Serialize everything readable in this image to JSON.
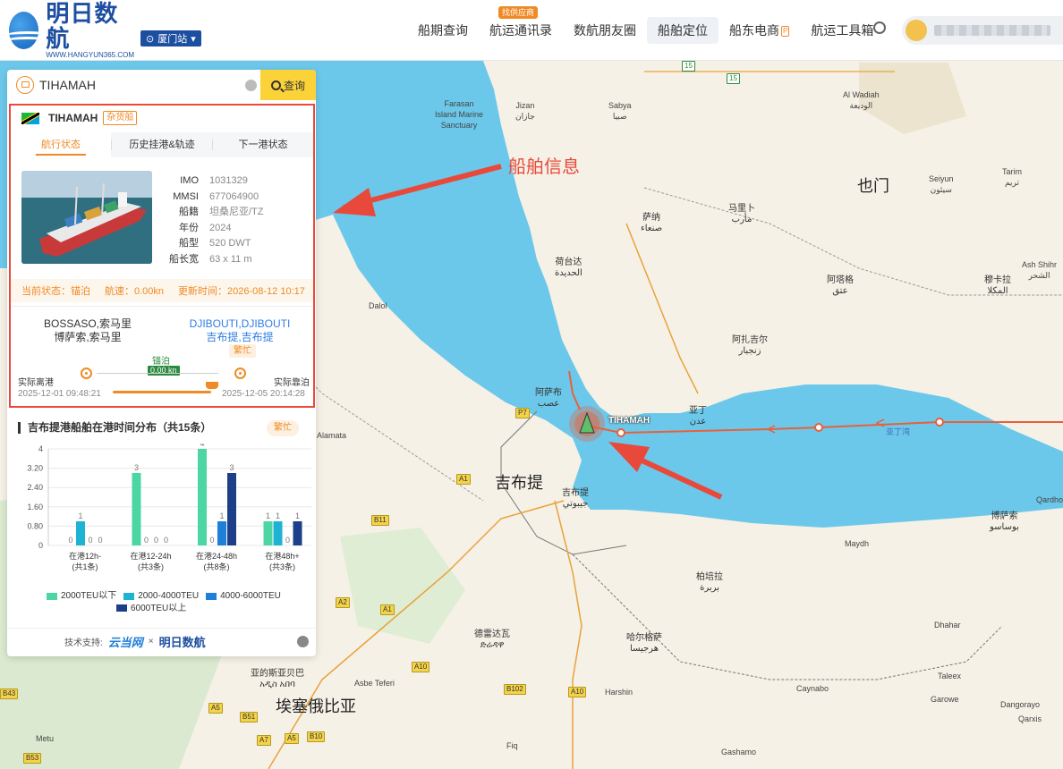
{
  "header": {
    "brand": "明日数航",
    "url": "WWW.HANGYUN365.COM",
    "station": "厦门站",
    "nav": [
      {
        "label": "船期查询",
        "badge": ""
      },
      {
        "label": "航运通讯录",
        "badge": "找供应商"
      },
      {
        "label": "数航朋友圈",
        "badge": ""
      },
      {
        "label": "船舶定位",
        "badge": ""
      },
      {
        "label": "船东电商",
        "badge": "P"
      },
      {
        "label": "航运工具箱",
        "badge": ""
      }
    ]
  },
  "search": {
    "value": "TIHAMAH",
    "button": "查询"
  },
  "vessel": {
    "name": "TIHAMAH",
    "type": "杂货船",
    "tabs": [
      "航行状态",
      "历史挂港&轨迹",
      "下一港状态"
    ],
    "props": [
      {
        "key": "IMO",
        "value": "1031329"
      },
      {
        "key": "MMSI",
        "value": "677064900"
      },
      {
        "key": "船籍",
        "value": "坦桑尼亚/TZ"
      },
      {
        "key": "年份",
        "value": "2024"
      },
      {
        "key": "船型",
        "value": "520 DWT"
      },
      {
        "key": "船长宽",
        "value": "63 x 11 m"
      }
    ],
    "status": {
      "state": "当前状态：锚泊",
      "speed": "航速：0.00kn",
      "updated": "更新时间：2026-08-12 10:17"
    },
    "voyage": {
      "from_en": "BOSSASO,索马里",
      "from_cn": "博萨索,索马里",
      "to_en": "DJIBOUTI,DJIBOUTI",
      "to_cn": "吉布提,吉布提",
      "busy": "繁忙",
      "anchor": "锚泊",
      "speed": "0.00 kn",
      "dep_label": "实际离港",
      "dep_time": "2025-12-01 09:48:21",
      "arr_label": "实际靠泊",
      "arr_time": "2025-12-05 20:14:28"
    }
  },
  "chart_data": {
    "type": "bar",
    "title": "吉布提港船舶在港时间分布（共15条）",
    "badge": "繁忙",
    "categories": [
      "在港12h-",
      "在港12-24h",
      "在港24-48h",
      "在港48h+"
    ],
    "category_sub": [
      "(共1条)",
      "(共3条)",
      "(共8条)",
      "(共3条)"
    ],
    "yticks": [
      "4",
      "3.20",
      "2.40",
      "1.60",
      "0.80",
      "0"
    ],
    "ylim": [
      0,
      4
    ],
    "series": [
      {
        "name": "2000TEU以下",
        "color": "#4cd6a3",
        "values": [
          0,
          3,
          4,
          1
        ]
      },
      {
        "name": "2000-4000TEU",
        "color": "#1fb3d3",
        "values": [
          1,
          0,
          0,
          1
        ]
      },
      {
        "name": "4000-6000TEU",
        "color": "#1e7ed8",
        "values": [
          0,
          0,
          1,
          0
        ]
      },
      {
        "name": "6000TEU以上",
        "color": "#1d3f8a",
        "values": [
          0,
          0,
          3,
          1
        ]
      }
    ]
  },
  "footer": {
    "label": "技术支持:",
    "brand1": "云当网",
    "sep": "×",
    "brand2": "明日数航"
  },
  "map": {
    "callout": "船舶信息",
    "ship_label": "TIHAMAH",
    "route_label": "亚丁湾",
    "places": [
      {
        "name": "也门",
        "cls": "big"
      },
      {
        "name": "吉布提",
        "cls": "big"
      },
      {
        "name": "埃塞俄比亚",
        "cls": "big"
      },
      {
        "name": "萨纳\nصنعاء",
        "cls": ""
      },
      {
        "name": "亚丁\nعدن",
        "cls": ""
      },
      {
        "name": "吉布提\nجيبوتي",
        "cls": ""
      },
      {
        "name": "Farasan\nIsland Marine\nSanctuary",
        "cls": "small"
      },
      {
        "name": "荷台达\nالحديدة",
        "cls": ""
      },
      {
        "name": "马里卜\nمأرب",
        "cls": ""
      },
      {
        "name": "穆卡拉\nالمكلا",
        "cls": ""
      },
      {
        "name": "阿塔格\nعتق",
        "cls": ""
      },
      {
        "name": "柏培拉\nبربرة",
        "cls": ""
      },
      {
        "name": "博萨索\nبوساسو",
        "cls": ""
      },
      {
        "name": "阿萨布\nعصب",
        "cls": ""
      },
      {
        "name": "哈尔格萨\nهرجيسا",
        "cls": ""
      },
      {
        "name": "德雷达瓦\nድሬዳዋ",
        "cls": ""
      },
      {
        "name": "亚的斯亚贝巴\nአዲስ አበባ",
        "cls": ""
      },
      {
        "name": "阿扎吉尔\nزنجبار",
        "cls": ""
      },
      {
        "name": "Seiyun\nسيئون",
        "cls": "small"
      },
      {
        "name": "Tarim\nتريم",
        "cls": "small"
      },
      {
        "name": "Ash Shihr\nالشحر",
        "cls": "small"
      },
      {
        "name": "Al Wadiah\nالوديعة",
        "cls": "small"
      },
      {
        "name": "Maydh",
        "cls": "small"
      },
      {
        "name": "Dhahar",
        "cls": "small"
      },
      {
        "name": "Qardho",
        "cls": "small"
      },
      {
        "name": "Garowe",
        "cls": "small"
      },
      {
        "name": "Taleex",
        "cls": "small"
      },
      {
        "name": "Caynabo",
        "cls": "small"
      },
      {
        "name": "Gashamo",
        "cls": "small"
      },
      {
        "name": "Harshin",
        "cls": "small"
      },
      {
        "name": "Jizan\nجازان",
        "cls": "small"
      },
      {
        "name": "Sabya\nصبيا",
        "cls": "small"
      },
      {
        "name": "Dalol",
        "cls": "small"
      },
      {
        "name": "Alamata",
        "cls": "small"
      },
      {
        "name": "Asbe Teferi",
        "cls": "small"
      },
      {
        "name": "Metu",
        "cls": "small"
      },
      {
        "name": "Fiq",
        "cls": "small"
      },
      {
        "name": "Dangorayo",
        "cls": "small"
      },
      {
        "name": "Qarxis",
        "cls": "small"
      }
    ]
  }
}
